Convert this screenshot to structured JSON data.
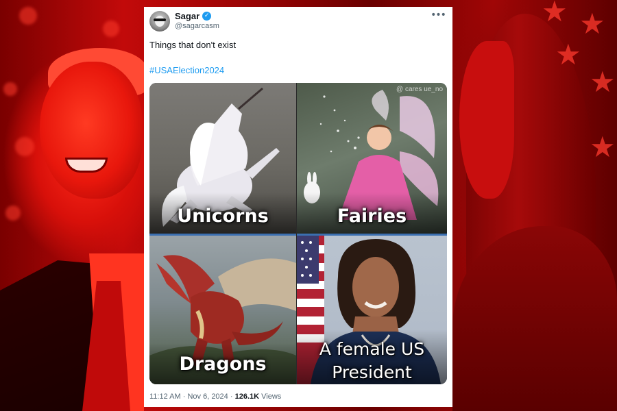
{
  "tweet": {
    "display_name": "Sagar",
    "handle": "@sagarcasm",
    "verified_icon": "verified-check-icon",
    "more_icon": "more-options-icon",
    "text": "Things that don't exist",
    "hashtag": "#USAElection2024",
    "media": {
      "watermark": "@ cares  ue_no",
      "panels": [
        {
          "caption": "Unicorns"
        },
        {
          "caption": "Fairies"
        },
        {
          "caption": "Dragons"
        },
        {
          "caption_line1": "A female US",
          "caption_line2": "President"
        }
      ]
    },
    "time": "11:12 AM",
    "date": "Nov 6, 2024",
    "separator": "·",
    "views_count": "126.1K",
    "views_label": "Views"
  },
  "colors": {
    "link": "#1d9bf0",
    "background_red": "#c20a0a",
    "text_primary": "#0f1419",
    "text_secondary": "#536471"
  }
}
